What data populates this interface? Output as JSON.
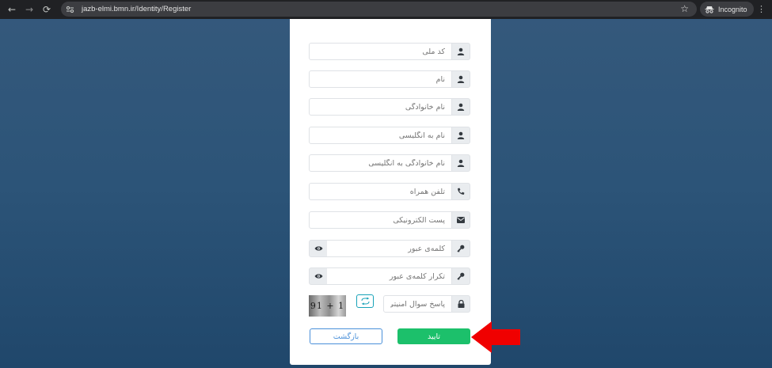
{
  "browser": {
    "url": "jazb-elmi.bmn.ir/Identity/Register",
    "incognito_label": "Incognito"
  },
  "form": {
    "fields": [
      {
        "placeholder": "کد ملی",
        "icon": "user-icon"
      },
      {
        "placeholder": "نام",
        "icon": "user-icon"
      },
      {
        "placeholder": "نام خانوادگی",
        "icon": "user-icon"
      },
      {
        "placeholder": "نام به انگلیسی",
        "icon": "user-icon"
      },
      {
        "placeholder": "نام خانوادگی به انگلیسی",
        "icon": "user-icon"
      },
      {
        "placeholder": "تلفن همراه",
        "icon": "phone-icon"
      },
      {
        "placeholder": "پست الکترونیکی",
        "icon": "envelope-icon"
      }
    ],
    "password": {
      "placeholder": "کلمه‌ی عبور",
      "icon": "key-icon",
      "toggle_icon": "eye-icon"
    },
    "password_confirm": {
      "placeholder": "تکرار کلمه‌ی عبور",
      "icon": "key-icon",
      "toggle_icon": "eye-icon"
    },
    "security": {
      "placeholder": "پاسخ سوال امنیتی",
      "icon": "lock-icon",
      "captcha_text": "91 + 1",
      "refresh_icon": "refresh-icon"
    },
    "submit_label": "تایید",
    "back_label": "بازگشت"
  },
  "colors": {
    "submit": "#1cc06b",
    "back_border": "#4a90d9",
    "annotation_arrow": "#f00000"
  }
}
